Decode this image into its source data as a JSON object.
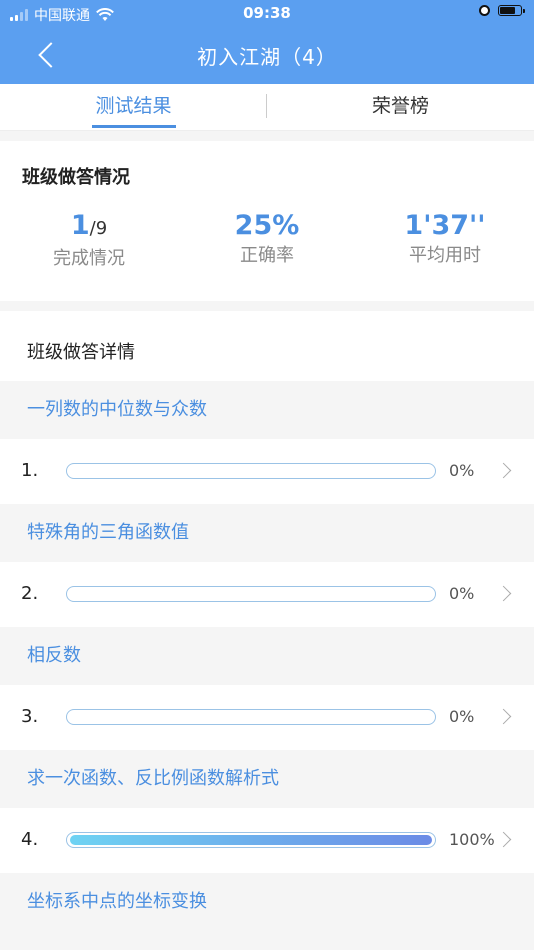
{
  "status_bar": {
    "carrier": "中国联通",
    "time": "09:38",
    "battery_level": 0.75
  },
  "header": {
    "title": "初入江湖（4）"
  },
  "tabs": [
    {
      "label": "测试结果",
      "active": true
    },
    {
      "label": "荣誉榜",
      "active": false
    }
  ],
  "summary": {
    "title": "班级做答情况",
    "completion_done": "1",
    "completion_total": "/9",
    "completion_label": "完成情况",
    "accuracy_value": "25%",
    "accuracy_label": "正确率",
    "avg_time_value": "1'37''",
    "avg_time_label": "平均用时"
  },
  "detail": {
    "title": "班级做答详情",
    "topics": [
      {
        "name": "一列数的中位数与众数",
        "index": "1.",
        "percent_label": "0%",
        "percent": 0
      },
      {
        "name": "特殊角的三角函数值",
        "index": "2.",
        "percent_label": "0%",
        "percent": 0
      },
      {
        "name": "相反数",
        "index": "3.",
        "percent_label": "0%",
        "percent": 0
      },
      {
        "name": "求一次函数、反比例函数解析式",
        "index": "4.",
        "percent_label": "100%",
        "percent": 100
      },
      {
        "name": "坐标系中点的坐标变换"
      }
    ]
  },
  "colors": {
    "header_bg": "#5b9ff0",
    "accent": "#4b8fe0",
    "bar_gradient_start": "#6fd3f3",
    "bar_gradient_end": "#6b8be6"
  }
}
